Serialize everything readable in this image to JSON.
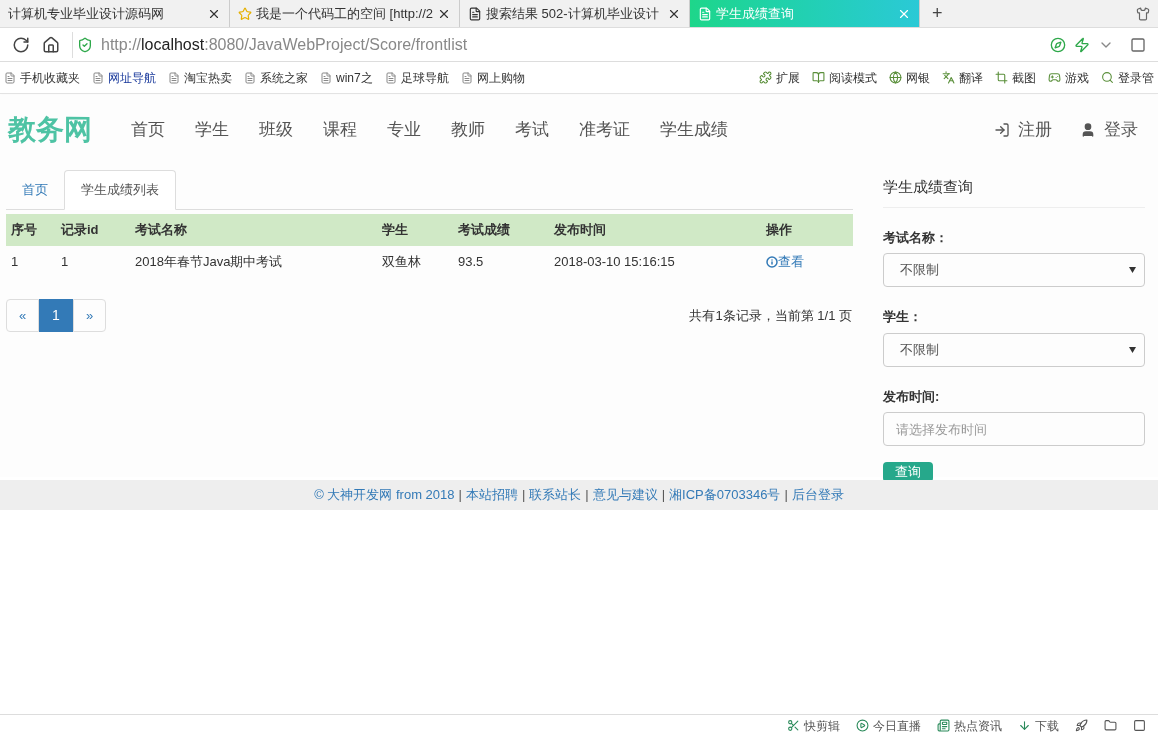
{
  "browser": {
    "tabs": [
      {
        "title": "计算机专业毕业设计源码网",
        "selected": false
      },
      {
        "title": "我是一个代码工的空间 [http://2",
        "selected": false
      },
      {
        "title": "搜索结果 502-计算机毕业设计",
        "selected": false
      },
      {
        "title": "学生成绩查询",
        "selected": true
      }
    ],
    "new_tab": "+",
    "url": "http://**localhost**:8080/JavaWebProject/Score/frontlist",
    "bookmarks": [
      "手机收藏夹",
      "网址导航",
      "淘宝热卖",
      "系统之家",
      "win7之",
      "足球导航",
      "网上购物"
    ],
    "tools": [
      "扩展",
      "阅读模式",
      "网银",
      "翻译",
      "截图",
      "游戏",
      "登录管"
    ]
  },
  "navbar": {
    "brand": "教务网",
    "items": [
      "首页",
      "学生",
      "班级",
      "课程",
      "专业",
      "教师",
      "考试",
      "准考证",
      "学生成绩"
    ],
    "register": "注册",
    "login": "登录"
  },
  "content_tabs": [
    {
      "label": "首页",
      "selected": false
    },
    {
      "label": "学生成绩列表",
      "selected": true
    }
  ],
  "table": {
    "columns": [
      "序号",
      "记录id",
      "考试名称",
      "学生",
      "考试成绩",
      "发布时间",
      "操作"
    ],
    "rows": [
      {
        "cells": [
          "1",
          "1",
          "2018年春节Java期中考试",
          "双鱼林",
          "93.5",
          "2018-03-10 15:16:15"
        ],
        "action": "查看"
      }
    ]
  },
  "pagination": {
    "prev": "«",
    "pages": [
      {
        "label": "1",
        "selected": true
      }
    ],
    "next": "»",
    "summary": "共有1条记录，当前第 1/1 页"
  },
  "query": {
    "title": "学生成绩查询",
    "fields": [
      {
        "kind": "select",
        "label": "考试名称：",
        "value": "不限制"
      },
      {
        "kind": "select",
        "label": "学生：",
        "value": "不限制"
      },
      {
        "kind": "text",
        "label": "发布时间:",
        "placeholder": "请选择发布时间"
      }
    ],
    "submit": "查询"
  },
  "footer": {
    "separator": "|",
    "items": [
      "© 大神开发网 from 2018",
      "本站招聘",
      "联系站长",
      "意见与建议",
      "湘ICP备0703346号",
      "后台登录"
    ]
  },
  "status_bar": {
    "items": [
      "快剪辑",
      "今日直播",
      "热点资讯",
      "下载"
    ]
  }
}
